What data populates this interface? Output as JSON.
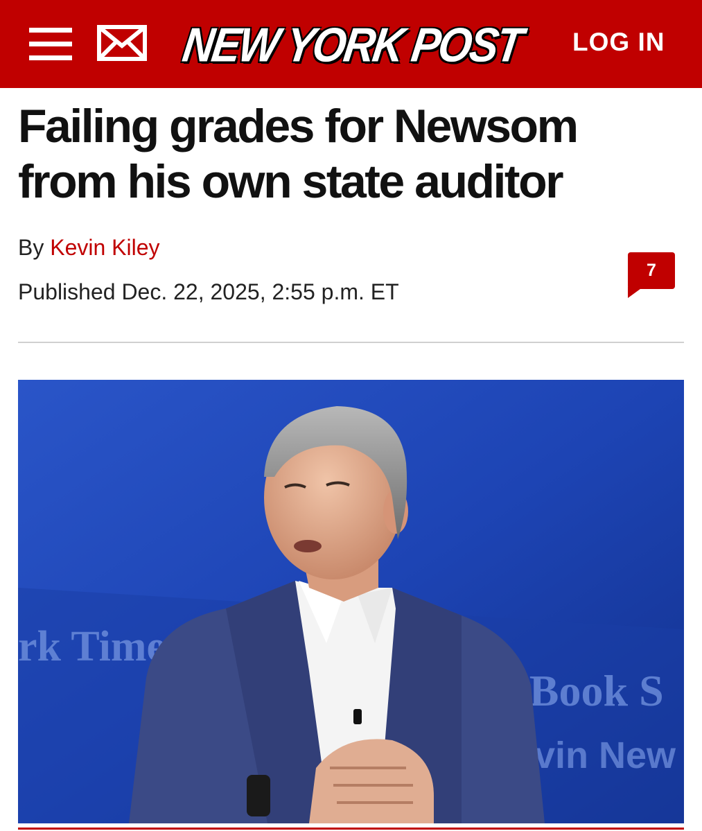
{
  "header": {
    "logo_text": "NEW YORK POST",
    "login_label": "LOG IN",
    "menu_icon": "hamburger-menu-icon",
    "mail_icon": "envelope-icon",
    "brand_color": "#c00000"
  },
  "article": {
    "headline": "Failing grades for Newsom from his own state auditor",
    "byline_prefix": "By",
    "author": "Kevin Kiley",
    "published": "Published Dec. 22, 2025, 2:55 p.m. ET",
    "comment_count": "7"
  },
  "photo": {
    "backdrop_text_left": "rk Time",
    "backdrop_text_right_1": "lBook S",
    "backdrop_text_right_2": "vin New",
    "background_color": "#1f47b8"
  }
}
